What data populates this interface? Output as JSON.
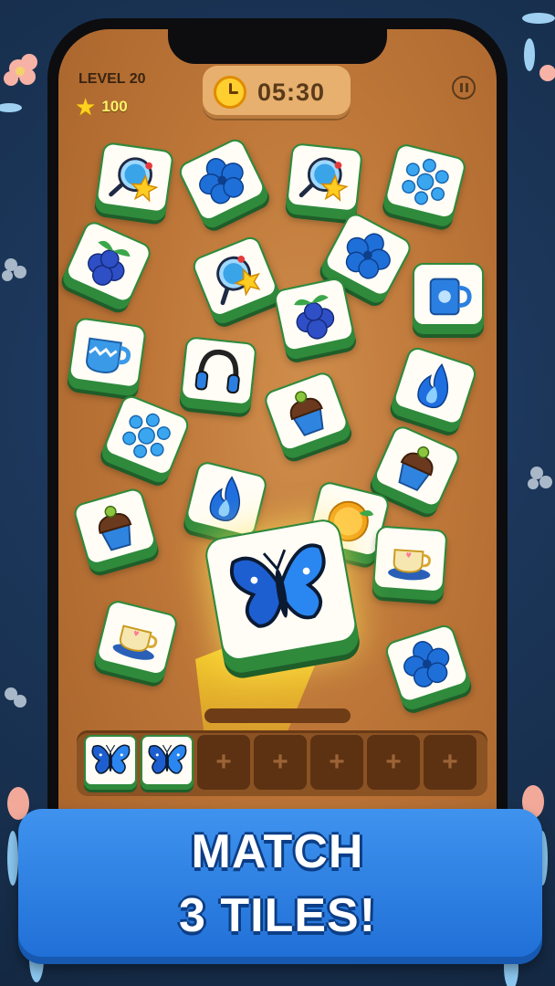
{
  "hud": {
    "level_label": "LEVEL 20",
    "star_icon": "star-icon",
    "stars": "100",
    "timer": "05:30",
    "timer_icon": "alarm-clock-icon",
    "pause_icon": "pause-icon"
  },
  "board": {
    "tiles": [
      {
        "icon": "magnifier-star-icon"
      },
      {
        "icon": "blue-flower-icon"
      },
      {
        "icon": "magnifier-star-icon"
      },
      {
        "icon": "snowflake-icon"
      },
      {
        "icon": "blueberries-icon"
      },
      {
        "icon": "magnifier-star-icon"
      },
      {
        "icon": "blue-flower-icon"
      },
      {
        "icon": "blue-mug-icon"
      },
      {
        "icon": "blueberries-icon"
      },
      {
        "icon": "zigzag-mug-icon"
      },
      {
        "icon": "headphones-icon"
      },
      {
        "icon": "blue-flame-icon"
      },
      {
        "icon": "cupcake-icon"
      },
      {
        "icon": "snowflake-icon"
      },
      {
        "icon": "cupcake-icon"
      },
      {
        "icon": "blue-flame-icon"
      },
      {
        "icon": "cupcake-icon"
      },
      {
        "icon": "orange-icon"
      },
      {
        "icon": "teacup-icon"
      },
      {
        "icon": "butterfly-icon"
      },
      {
        "icon": "teacup-icon"
      },
      {
        "icon": "blue-flower-icon"
      }
    ],
    "selected_tile": {
      "icon": "butterfly-icon"
    }
  },
  "tray": {
    "filled": [
      {
        "icon": "butterfly-icon"
      },
      {
        "icon": "butterfly-icon"
      }
    ],
    "empty_slot_label": "+",
    "empty_slots": 5
  },
  "banner": {
    "line1": "MATCH",
    "line2": "3 TILES!"
  },
  "colors": {
    "tile_border": "#2f8a3c",
    "board_wood": "#c27d3e",
    "banner_blue": "#2f80e3",
    "background": "#1d3557"
  }
}
